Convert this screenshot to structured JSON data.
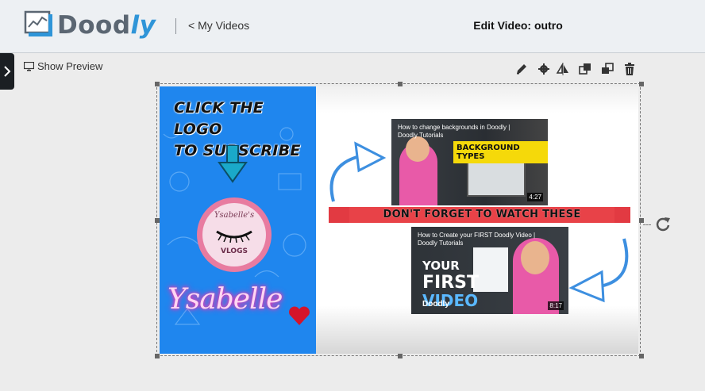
{
  "header": {
    "logo_text": "Doodly",
    "back_label": "< My Videos",
    "title": "Edit Video: outro"
  },
  "preview": {
    "label": "Show Preview"
  },
  "toolbar": {
    "tools": [
      "pencil-icon",
      "gear-icon",
      "flip-icon",
      "bring-forward-icon",
      "send-backward-icon",
      "trash-icon"
    ]
  },
  "scene": {
    "cta_line1": "CLICK THE LOGO",
    "cta_line2": "TO SUBSCRIBE",
    "badge_top": "Ysabelle's",
    "badge_bottom": "VLOGS",
    "signature": "Ysabelle",
    "banner": "DON'T FORGET TO WATCH THESE",
    "videos": [
      {
        "title": "How to change backgrounds in Doodly | Doodly Tutorials",
        "overlay": "BACKGROUND TYPES",
        "duration": "4:27"
      },
      {
        "title": "How to Create your FIRST Doodly Video | Doodly Tutorials",
        "overlay_line1": "YOUR",
        "overlay_line2": "FIRST",
        "overlay_line3": "VIDEO",
        "brand": "Doodly",
        "duration": "8:17"
      }
    ]
  },
  "colors": {
    "accent": "#2f95d8",
    "left_panel": "#1f86ee",
    "banner": "#e84248",
    "badge": "#e87ba0"
  }
}
